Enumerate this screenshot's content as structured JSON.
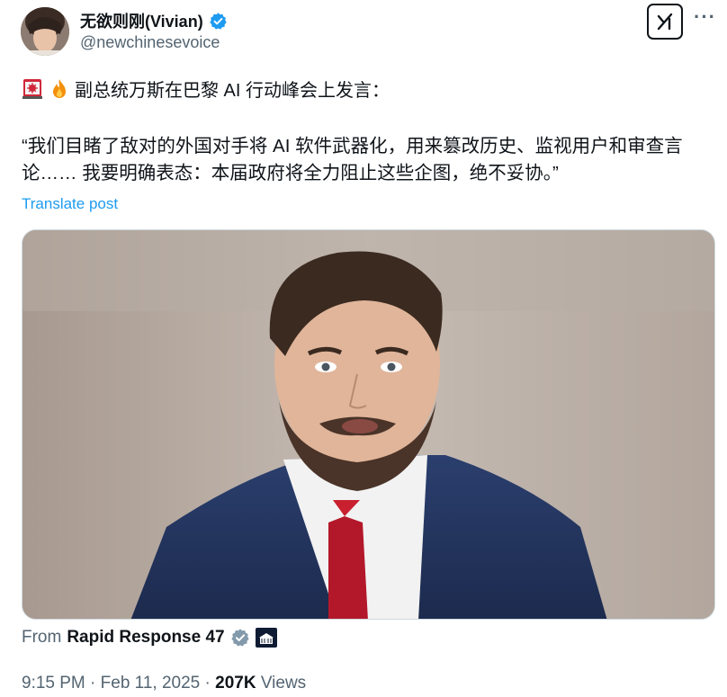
{
  "author": {
    "display_name": "无欲则刚(Vivian)",
    "handle": "@newchinesevoice"
  },
  "post": {
    "headline": "副总统万斯在巴黎 AI 行动峰会上发言：",
    "quote": "“我们目睹了敌对的外国对手将 AI 软件武器化，用来篡改历史、监视用户和审查言论…… 我要明确表态：本届政府将全力阻止这些企图，绝不妥协。”",
    "translate_label": "Translate post"
  },
  "media": {
    "source_prefix": "From",
    "source_name": "Rapid Response 47"
  },
  "meta": {
    "time": "9:15 PM",
    "separator1": "·",
    "date": "Feb 11, 2025",
    "separator2": "·",
    "views_count": "207K",
    "views_label": "Views"
  },
  "icons": {
    "headline_emojis": [
      "siren-icon",
      "fire-icon"
    ],
    "verified_color": "#1d9bf0",
    "org_verified_color": "#829aab"
  }
}
